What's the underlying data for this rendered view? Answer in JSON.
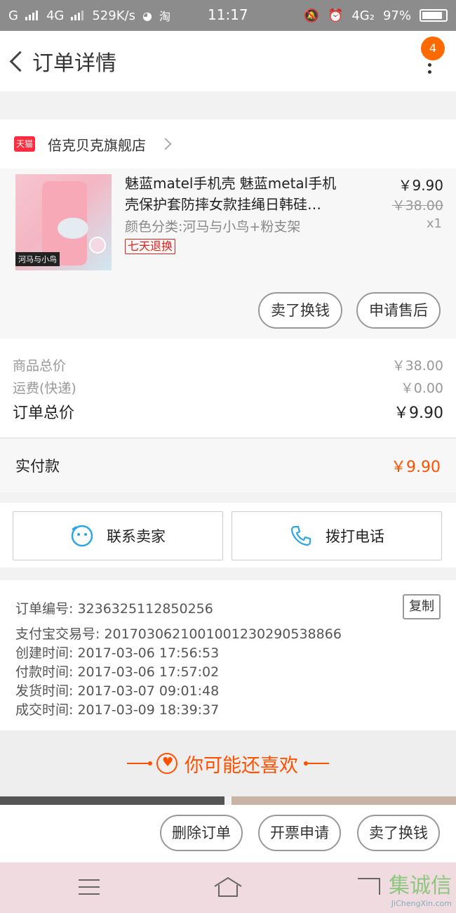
{
  "status_bar": {
    "carrier": "G",
    "network": "4G",
    "speed_num": "52",
    "speed_unit": "9K/s",
    "app_tag": "淘",
    "time": "11:17",
    "network2": "4G₂",
    "battery_pct": "97%"
  },
  "header": {
    "title": "订单详情",
    "badge_count": "4"
  },
  "shop": {
    "platform_label": "天猫",
    "name": "倍克贝克旗舰店"
  },
  "item": {
    "title": "魅蓝matel手机壳 魅蓝metal手机壳保护套防摔女款挂绳日韩硅…",
    "sku": "颜色分类:河马与小鸟+粉支架",
    "return_tag": "七天退换",
    "thumb_label": "河马与小鸟",
    "price": "￥9.90",
    "orig_price": "￥38.00",
    "qty": "x1",
    "btn_sell": "卖了换钱",
    "btn_after_sale": "申请售后"
  },
  "summary": {
    "goods_label": "商品总价",
    "goods_value": "￥38.00",
    "shipping_label": "运费(快递)",
    "shipping_value": "￥0.00",
    "total_label": "订单总价",
    "total_value": "￥9.90",
    "paid_label": "实付款",
    "paid_value": "￥9.90"
  },
  "contact": {
    "seller": "联系卖家",
    "phone": "拨打电话"
  },
  "info": {
    "order_no": "订单编号: 3236325112850256",
    "copy": "复制",
    "alipay_no": "支付宝交易号: 2017030621001001230290538866",
    "created": "创建时间: 2017-03-06  17:56:53",
    "paid": "付款时间: 2017-03-06  17:57:02",
    "shipped": "发货时间: 2017-03-07  09:01:48",
    "completed": "成交时间: 2017-03-09  18:39:37"
  },
  "recommend": {
    "title": "你可能还喜欢"
  },
  "actions": {
    "delete": "删除订单",
    "invoice": "开票申请",
    "sell": "卖了换钱"
  },
  "watermark": {
    "logo": "集诚信",
    "site": "JiChengXin.com"
  },
  "colors": {
    "accent": "#ff5000",
    "badge": "#ff6a00",
    "tmall": "#ff2b3e",
    "return_tag": "#e0201b",
    "contact_icon": "#2aa6e8"
  }
}
